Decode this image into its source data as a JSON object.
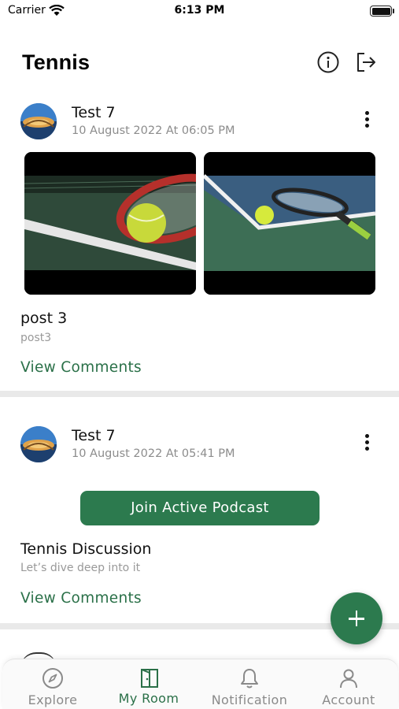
{
  "status_bar": {
    "carrier": "Carrier",
    "time": "6:13 PM"
  },
  "header": {
    "title": "Tennis",
    "info_icon": "info-icon",
    "logout_icon": "logout-icon"
  },
  "posts": [
    {
      "author": "Test 7",
      "date": "10 August 2022 At 06:05 PM",
      "title": "post 3",
      "subtitle": "post3",
      "view_comments": "View Comments"
    },
    {
      "author": "Test 7",
      "date": "10 August 2022 At 05:41 PM",
      "action_button": "Join Active Podcast",
      "title": "Tennis Discussion",
      "subtitle": "Let’s dive deep into it",
      "view_comments": "View Comments"
    }
  ],
  "tabs": [
    {
      "label": "Explore",
      "icon": "compass-icon"
    },
    {
      "label": "My Room",
      "icon": "door-icon",
      "active": true
    },
    {
      "label": "Notification",
      "icon": "bell-icon"
    },
    {
      "label": "Account",
      "icon": "person-icon"
    }
  ],
  "colors": {
    "accent": "#2c7a4e",
    "link": "#2a7048",
    "muted": "#8c8c8c"
  }
}
